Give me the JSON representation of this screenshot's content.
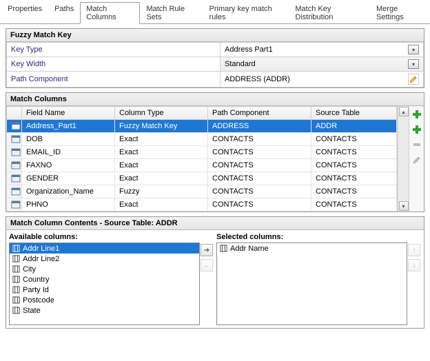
{
  "tabs": {
    "items": [
      {
        "label": "Properties"
      },
      {
        "label": "Paths"
      },
      {
        "label": "Match Columns"
      },
      {
        "label": "Match Rule Sets"
      },
      {
        "label": "Primary key match rules"
      },
      {
        "label": "Match Key Distribution"
      },
      {
        "label": "Merge Settings"
      }
    ],
    "active_index": 2
  },
  "fuzzy_panel": {
    "title": "Fuzzy Match Key",
    "rows": {
      "key_type": {
        "label": "Key Type",
        "value": "Address Part1",
        "control": "combo"
      },
      "key_width": {
        "label": "Key Width",
        "value": "Standard",
        "control": "combo"
      },
      "path_comp": {
        "label": "Path Component",
        "value": "ADDRESS (ADDR)",
        "control": "edit"
      }
    }
  },
  "columns_panel": {
    "title": "Match Columns",
    "headers": {
      "field": "Field Name",
      "coltype": "Column Type",
      "path": "Path Component",
      "source": "Source Table"
    },
    "rows": [
      {
        "field": "Address_Part1",
        "coltype": "Fuzzy Match Key",
        "path": "ADDRESS",
        "source": "ADDR",
        "selected": true
      },
      {
        "field": "DOB",
        "coltype": "Exact",
        "path": "CONTACTS",
        "source": "CONTACTS"
      },
      {
        "field": "EMAIL_ID",
        "coltype": "Exact",
        "path": "CONTACTS",
        "source": "CONTACTS"
      },
      {
        "field": "FAXNO",
        "coltype": "Exact",
        "path": "CONTACTS",
        "source": "CONTACTS"
      },
      {
        "field": "GENDER",
        "coltype": "Exact",
        "path": "CONTACTS",
        "source": "CONTACTS"
      },
      {
        "field": "Organization_Name",
        "coltype": "Fuzzy",
        "path": "CONTACTS",
        "source": "CONTACTS"
      },
      {
        "field": "PHNO",
        "coltype": "Exact",
        "path": "CONTACTS",
        "source": "CONTACTS"
      }
    ]
  },
  "contents_panel": {
    "title": "Match Column Contents - Source Table: ADDR",
    "available_label": "Available columns:",
    "selected_label": "Selected columns:",
    "available": [
      {
        "label": "Addr Line1",
        "selected": true
      },
      {
        "label": "Addr Line2"
      },
      {
        "label": "City"
      },
      {
        "label": "Country"
      },
      {
        "label": "Party Id"
      },
      {
        "label": "Postcode"
      },
      {
        "label": "State"
      }
    ],
    "selected": [
      {
        "label": "Addr Name"
      }
    ]
  }
}
